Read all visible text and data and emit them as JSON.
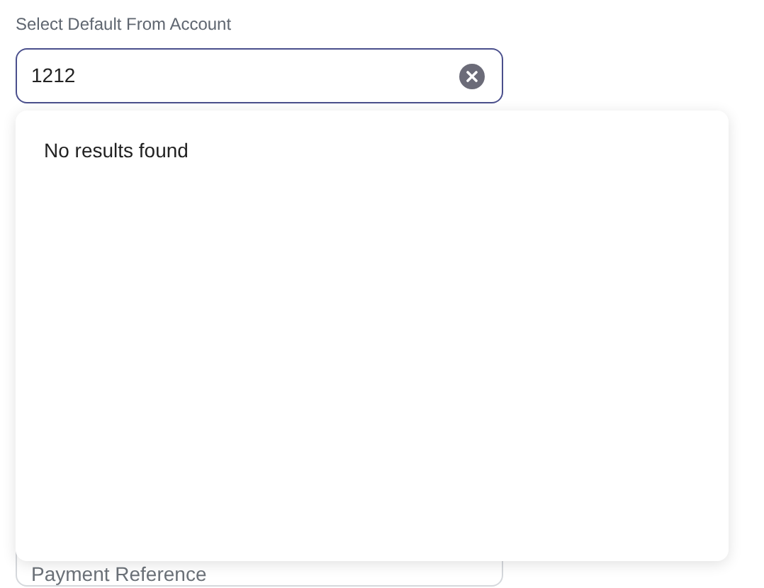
{
  "account_field": {
    "label": "Select Default From Account",
    "value": "1212"
  },
  "dropdown": {
    "message": "No results found"
  },
  "payment_reference_field": {
    "placeholder": "Payment Reference"
  }
}
